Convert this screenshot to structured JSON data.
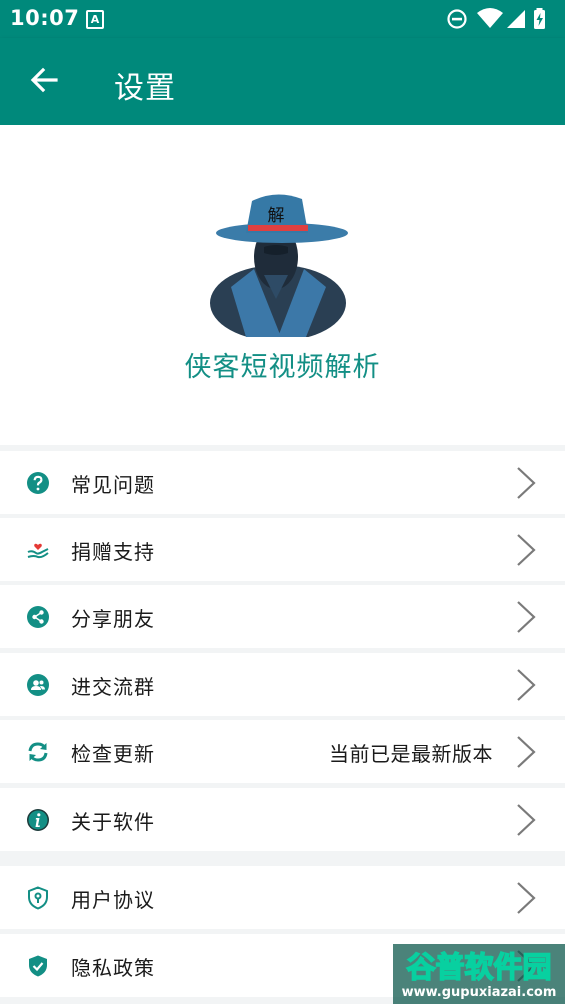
{
  "status_bar": {
    "time": "10:07",
    "notification_icon": "A",
    "icons": [
      "do-not-disturb-icon",
      "wifi-icon",
      "signal-icon",
      "battery-charging-icon"
    ]
  },
  "app_bar": {
    "back_icon": "arrow-left-icon",
    "title": "设置"
  },
  "header": {
    "logo_icon": "detective-logo",
    "logo_hat_text": "解",
    "app_name": "侠客短视频解析"
  },
  "menu": [
    {
      "label": "常见问题",
      "icon": "help-circle-icon",
      "value": ""
    },
    {
      "label": "捐赠支持",
      "icon": "heart-hand-icon",
      "value": ""
    },
    {
      "label": "分享朋友",
      "icon": "share-icon",
      "value": ""
    },
    {
      "label": "进交流群",
      "icon": "group-icon",
      "value": ""
    },
    {
      "label": "检查更新",
      "icon": "refresh-icon",
      "value": "当前已是最新版本"
    },
    {
      "label": "关于软件",
      "icon": "info-icon",
      "value": ""
    },
    {
      "label": "用户协议",
      "icon": "shield-lock-icon",
      "value": ""
    },
    {
      "label": "隐私政策",
      "icon": "shield-check-icon",
      "value": ""
    }
  ],
  "colors": {
    "primary": "#00897b",
    "accent": "#138f85",
    "background": "#f2f4f5",
    "chevron": "#7a7a7a"
  },
  "watermark": {
    "title": "谷普软件园",
    "url": "www.gupuxiazai.com"
  }
}
